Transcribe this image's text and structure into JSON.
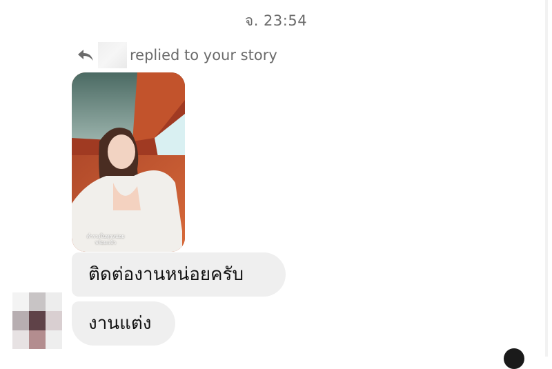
{
  "conversation": {
    "timestamp": "จ. 23:54",
    "reply_header": {
      "icon": "reply-arrow-icon",
      "sender_name": "",
      "text": "replied to your story"
    },
    "story": {
      "overlay_text_line1": "ค่ำรวงในทุกหน่อย",
      "overlay_text_line2": "พร้อมแป้ว"
    },
    "messages": [
      {
        "text": "ติดต่องานหน่อยครับ"
      },
      {
        "text": "งานแต่ง"
      }
    ],
    "avatar": {
      "icon": "avatar-pixelated"
    }
  }
}
